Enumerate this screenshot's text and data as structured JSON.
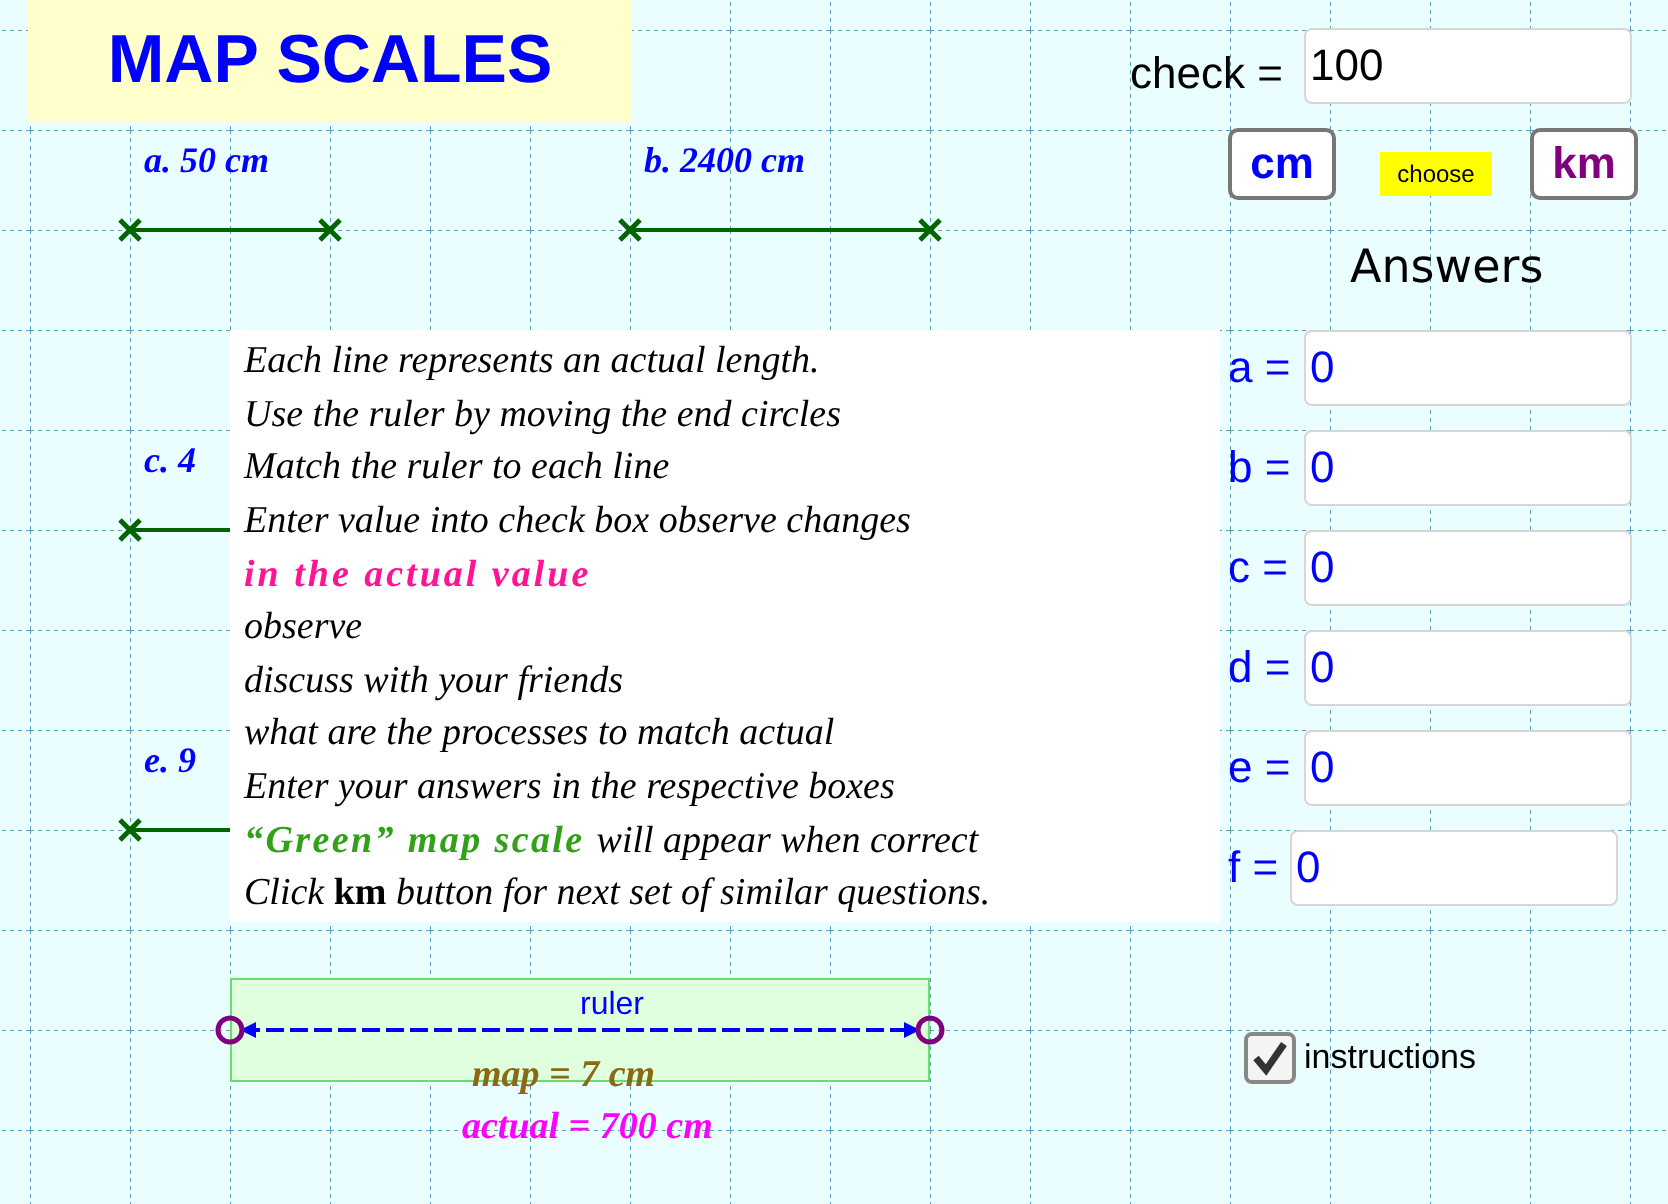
{
  "title": "MAP SCALES",
  "check": {
    "label": "check =",
    "value": "100"
  },
  "unit_buttons": [
    {
      "label": "cm",
      "kind": "cm"
    },
    {
      "label": "choose",
      "kind": "choose"
    },
    {
      "label": "km",
      "kind": "km"
    }
  ],
  "lines": [
    {
      "label": "a. 50 cm",
      "kind": "full"
    },
    {
      "label": "b. 2400 cm",
      "kind": "full"
    },
    {
      "label": "c. 4",
      "kind": "partial"
    },
    {
      "label": "e. 9",
      "kind": "partial"
    }
  ],
  "instructions_panel": [
    [
      {
        "text": "Each line represents an actual length.",
        "kind": "plain"
      }
    ],
    [
      {
        "text": "Use the ruler by moving the end circles",
        "kind": "plain"
      }
    ],
    [
      {
        "text": "Match the ruler to each line",
        "kind": "plain"
      }
    ],
    [
      {
        "text": "Enter value into check box observe changes",
        "kind": "plain"
      }
    ],
    [
      {
        "text": "in the actual value",
        "kind": "pink"
      }
    ],
    [
      {
        "text": "observe",
        "kind": "plain"
      }
    ],
    [
      {
        "text": "discuss with your friends",
        "kind": "plain"
      }
    ],
    [
      {
        "text": "what are the processes to match actual",
        "kind": "plain"
      }
    ],
    [
      {
        "text": "Enter your answers in the respective boxes",
        "kind": "plain"
      }
    ],
    [
      {
        "text": "“Green” map scale",
        "kind": "green"
      },
      {
        "text": "will appear when correct",
        "kind": "plain"
      }
    ],
    [
      {
        "text": "Click **km** button for next set of similar questions.",
        "kind": "plain"
      }
    ]
  ],
  "answers": {
    "heading": "Answers",
    "fields": [
      {
        "label": "a =",
        "value": "0"
      },
      {
        "label": "b =",
        "value": "0"
      },
      {
        "label": "c =",
        "value": "0"
      },
      {
        "label": "d =",
        "value": "0"
      },
      {
        "label": "e =",
        "value": "0"
      },
      {
        "label": "f =",
        "value": "0"
      }
    ]
  },
  "ruler": {
    "label": "ruler",
    "map": "map = 7 cm",
    "actual": "actual = 700 cm"
  },
  "instructions": {
    "label": "instructions",
    "checked": true
  }
}
